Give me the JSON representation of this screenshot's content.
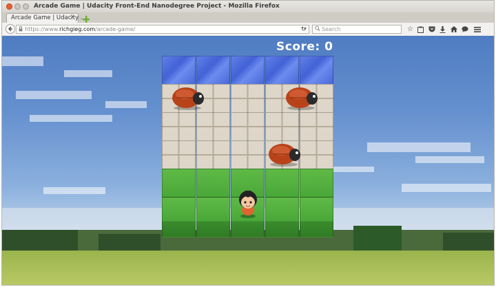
{
  "window": {
    "title": "Arcade Game | Udacity Front-End Nanodegree Project - Mozilla Firefox"
  },
  "tab": {
    "label": "Arcade Game | Udacity ...",
    "close": "×"
  },
  "navbar": {
    "url_prefix": "https://www.",
    "url_domain": "richgieg.com",
    "url_path": "/arcade-game/",
    "search_placeholder": "Search"
  },
  "game": {
    "score_label": "Score: 0",
    "rows": [
      "water",
      "stone",
      "stone",
      "stone",
      "grass",
      "grass"
    ],
    "columns": 5,
    "enemies": [
      {
        "row": 1,
        "col": 0.5
      },
      {
        "row": 1,
        "col": 3.8
      },
      {
        "row": 3,
        "col": 3.3
      }
    ],
    "player": {
      "row": 5,
      "col": 2
    }
  },
  "colors": {
    "close_button": "#e95e30",
    "score_text": "#ffffff"
  }
}
